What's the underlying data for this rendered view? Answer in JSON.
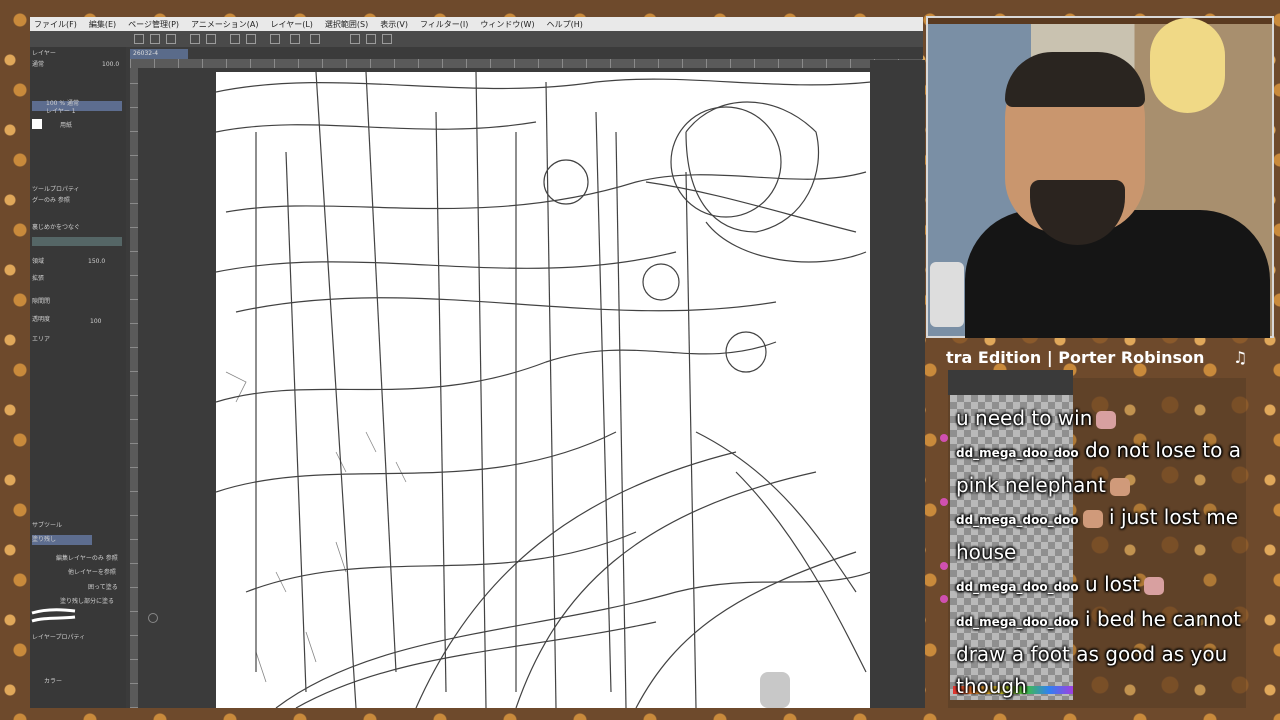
{
  "app": {
    "menu": [
      "ファイル(F)",
      "編集(E)",
      "ページ管理(P)",
      "アニメーション(A)",
      "レイヤー(L)",
      "選択範囲(S)",
      "表示(V)",
      "フィルター(I)",
      "ウィンドウ(W)",
      "ヘルプ(H)"
    ],
    "document_tab": "26032-4",
    "left_panel": {
      "rows": [
        "レイヤー",
        "通常",
        "100.0",
        "100 % 通常",
        "レイヤー 1",
        "用紙",
        "ツールプロパティ",
        "グーのみ 参照",
        "裏じめかをつなぐ",
        "領域",
        "150.0",
        "拡張",
        "隙間閉",
        "透明度",
        "100",
        "エリア",
        "サブツール",
        "塗り残し",
        "編集レイヤーのみ 参照",
        "他レイヤーを参照",
        "囲って塗る",
        "塗り残し部分に塗る",
        "レイヤープロパティ",
        "カラー"
      ]
    }
  },
  "stream": {
    "song_title": "tra Edition | Porter Robinson",
    "note_icon": "music-note-icon",
    "chat": [
      {
        "user": "",
        "message": "u need to win",
        "emote": "cat-emote"
      },
      {
        "user": "dd_mega_doo_doo",
        "message": "do not lose to a pink nelephant",
        "emote": "face-emote"
      },
      {
        "user": "dd_mega_doo_doo",
        "message": "i just lost me house",
        "emote": "face-emote"
      },
      {
        "user": "dd_mega_doo_doo",
        "message": "u lost",
        "emote": "cat-emote"
      },
      {
        "user": "dd_mega_doo_doo",
        "message": "i bed he cannot draw a foot as good as you though",
        "emote": ""
      }
    ]
  },
  "colors": {
    "accent": "#5d6d8f",
    "chat_dot": "#d050b0"
  }
}
